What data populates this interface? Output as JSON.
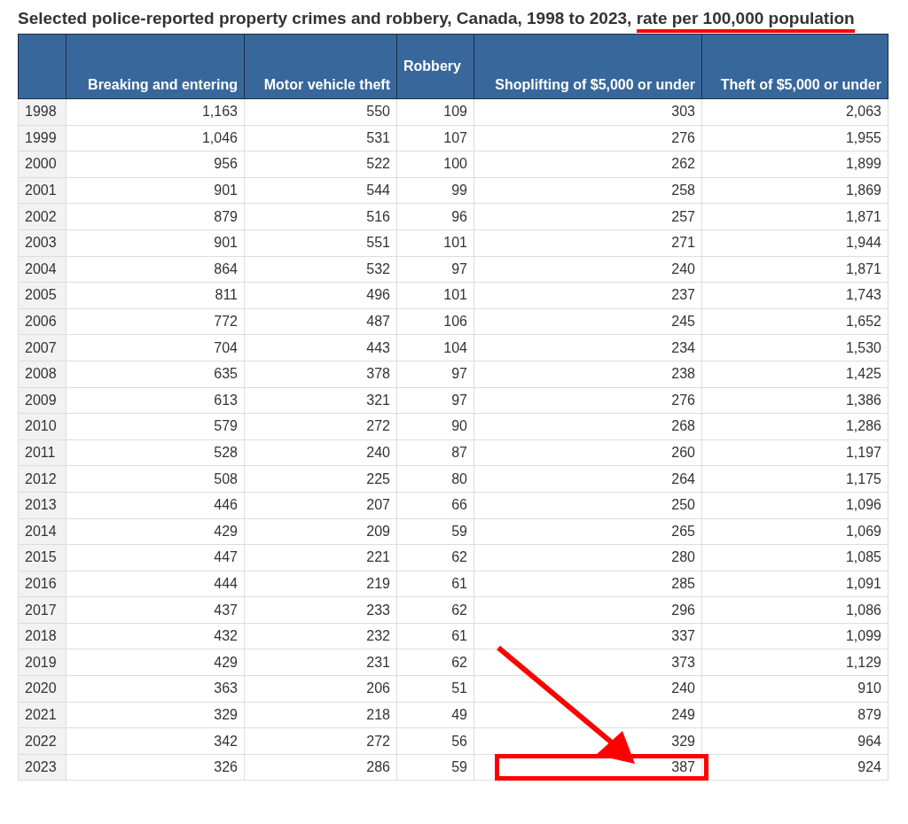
{
  "title": [
    {
      "text": "Selected police-reported property crimes and robbery, Canada, 1998 to 2023,",
      "underlined": false
    },
    {
      "text": "rate per 100,000 population",
      "underlined": true
    }
  ],
  "table": {
    "columns": [
      "",
      "Breaking and entering",
      "Motor vehicle theft",
      "Robbery",
      "Shoplifting of $5,000 or under",
      "Theft of $5,000 or under"
    ],
    "rows": [
      {
        "cells": [
          {
            "text": "1998",
            "boxed": false
          },
          {
            "text": "1,163",
            "boxed": false
          },
          {
            "text": "550",
            "boxed": false
          },
          {
            "text": "109",
            "boxed": false
          },
          {
            "text": "303",
            "boxed": false
          },
          {
            "text": "2,063",
            "boxed": false
          }
        ]
      },
      {
        "cells": [
          {
            "text": "1999",
            "boxed": false
          },
          {
            "text": "1,046",
            "boxed": false
          },
          {
            "text": "531",
            "boxed": false
          },
          {
            "text": "107",
            "boxed": false
          },
          {
            "text": "276",
            "boxed": false
          },
          {
            "text": "1,955",
            "boxed": false
          }
        ]
      },
      {
        "cells": [
          {
            "text": "2000",
            "boxed": false
          },
          {
            "text": "956",
            "boxed": false
          },
          {
            "text": "522",
            "boxed": false
          },
          {
            "text": "100",
            "boxed": false
          },
          {
            "text": "262",
            "boxed": false
          },
          {
            "text": "1,899",
            "boxed": false
          }
        ]
      },
      {
        "cells": [
          {
            "text": "2001",
            "boxed": false
          },
          {
            "text": "901",
            "boxed": false
          },
          {
            "text": "544",
            "boxed": false
          },
          {
            "text": "99",
            "boxed": false
          },
          {
            "text": "258",
            "boxed": false
          },
          {
            "text": "1,869",
            "boxed": false
          }
        ]
      },
      {
        "cells": [
          {
            "text": "2002",
            "boxed": false
          },
          {
            "text": "879",
            "boxed": false
          },
          {
            "text": "516",
            "boxed": false
          },
          {
            "text": "96",
            "boxed": false
          },
          {
            "text": "257",
            "boxed": false
          },
          {
            "text": "1,871",
            "boxed": false
          }
        ]
      },
      {
        "cells": [
          {
            "text": "2003",
            "boxed": false
          },
          {
            "text": "901",
            "boxed": false
          },
          {
            "text": "551",
            "boxed": false
          },
          {
            "text": "101",
            "boxed": false
          },
          {
            "text": "271",
            "boxed": false
          },
          {
            "text": "1,944",
            "boxed": false
          }
        ]
      },
      {
        "cells": [
          {
            "text": "2004",
            "boxed": false
          },
          {
            "text": "864",
            "boxed": false
          },
          {
            "text": "532",
            "boxed": false
          },
          {
            "text": "97",
            "boxed": false
          },
          {
            "text": "240",
            "boxed": false
          },
          {
            "text": "1,871",
            "boxed": false
          }
        ]
      },
      {
        "cells": [
          {
            "text": "2005",
            "boxed": false
          },
          {
            "text": "811",
            "boxed": false
          },
          {
            "text": "496",
            "boxed": false
          },
          {
            "text": "101",
            "boxed": false
          },
          {
            "text": "237",
            "boxed": false
          },
          {
            "text": "1,743",
            "boxed": false
          }
        ]
      },
      {
        "cells": [
          {
            "text": "2006",
            "boxed": false
          },
          {
            "text": "772",
            "boxed": false
          },
          {
            "text": "487",
            "boxed": false
          },
          {
            "text": "106",
            "boxed": false
          },
          {
            "text": "245",
            "boxed": false
          },
          {
            "text": "1,652",
            "boxed": false
          }
        ]
      },
      {
        "cells": [
          {
            "text": "2007",
            "boxed": false
          },
          {
            "text": "704",
            "boxed": false
          },
          {
            "text": "443",
            "boxed": false
          },
          {
            "text": "104",
            "boxed": false
          },
          {
            "text": "234",
            "boxed": false
          },
          {
            "text": "1,530",
            "boxed": false
          }
        ]
      },
      {
        "cells": [
          {
            "text": "2008",
            "boxed": false
          },
          {
            "text": "635",
            "boxed": false
          },
          {
            "text": "378",
            "boxed": false
          },
          {
            "text": "97",
            "boxed": false
          },
          {
            "text": "238",
            "boxed": false
          },
          {
            "text": "1,425",
            "boxed": false
          }
        ]
      },
      {
        "cells": [
          {
            "text": "2009",
            "boxed": false
          },
          {
            "text": "613",
            "boxed": false
          },
          {
            "text": "321",
            "boxed": false
          },
          {
            "text": "97",
            "boxed": false
          },
          {
            "text": "276",
            "boxed": false
          },
          {
            "text": "1,386",
            "boxed": false
          }
        ]
      },
      {
        "cells": [
          {
            "text": "2010",
            "boxed": false
          },
          {
            "text": "579",
            "boxed": false
          },
          {
            "text": "272",
            "boxed": false
          },
          {
            "text": "90",
            "boxed": false
          },
          {
            "text": "268",
            "boxed": false
          },
          {
            "text": "1,286",
            "boxed": false
          }
        ]
      },
      {
        "cells": [
          {
            "text": "2011",
            "boxed": false
          },
          {
            "text": "528",
            "boxed": false
          },
          {
            "text": "240",
            "boxed": false
          },
          {
            "text": "87",
            "boxed": false
          },
          {
            "text": "260",
            "boxed": false
          },
          {
            "text": "1,197",
            "boxed": false
          }
        ]
      },
      {
        "cells": [
          {
            "text": "2012",
            "boxed": false
          },
          {
            "text": "508",
            "boxed": false
          },
          {
            "text": "225",
            "boxed": false
          },
          {
            "text": "80",
            "boxed": false
          },
          {
            "text": "264",
            "boxed": false
          },
          {
            "text": "1,175",
            "boxed": false
          }
        ]
      },
      {
        "cells": [
          {
            "text": "2013",
            "boxed": false
          },
          {
            "text": "446",
            "boxed": false
          },
          {
            "text": "207",
            "boxed": false
          },
          {
            "text": "66",
            "boxed": false
          },
          {
            "text": "250",
            "boxed": false
          },
          {
            "text": "1,096",
            "boxed": false
          }
        ]
      },
      {
        "cells": [
          {
            "text": "2014",
            "boxed": false
          },
          {
            "text": "429",
            "boxed": false
          },
          {
            "text": "209",
            "boxed": false
          },
          {
            "text": "59",
            "boxed": false
          },
          {
            "text": "265",
            "boxed": false
          },
          {
            "text": "1,069",
            "boxed": false
          }
        ]
      },
      {
        "cells": [
          {
            "text": "2015",
            "boxed": false
          },
          {
            "text": "447",
            "boxed": false
          },
          {
            "text": "221",
            "boxed": false
          },
          {
            "text": "62",
            "boxed": false
          },
          {
            "text": "280",
            "boxed": false
          },
          {
            "text": "1,085",
            "boxed": false
          }
        ]
      },
      {
        "cells": [
          {
            "text": "2016",
            "boxed": false
          },
          {
            "text": "444",
            "boxed": false
          },
          {
            "text": "219",
            "boxed": false
          },
          {
            "text": "61",
            "boxed": false
          },
          {
            "text": "285",
            "boxed": false
          },
          {
            "text": "1,091",
            "boxed": false
          }
        ]
      },
      {
        "cells": [
          {
            "text": "2017",
            "boxed": false
          },
          {
            "text": "437",
            "boxed": false
          },
          {
            "text": "233",
            "boxed": false
          },
          {
            "text": "62",
            "boxed": false
          },
          {
            "text": "296",
            "boxed": false
          },
          {
            "text": "1,086",
            "boxed": false
          }
        ]
      },
      {
        "cells": [
          {
            "text": "2018",
            "boxed": false
          },
          {
            "text": "432",
            "boxed": false
          },
          {
            "text": "232",
            "boxed": false
          },
          {
            "text": "61",
            "boxed": false
          },
          {
            "text": "337",
            "boxed": false
          },
          {
            "text": "1,099",
            "boxed": false
          }
        ]
      },
      {
        "cells": [
          {
            "text": "2019",
            "boxed": false
          },
          {
            "text": "429",
            "boxed": false
          },
          {
            "text": "231",
            "boxed": false
          },
          {
            "text": "62",
            "boxed": false
          },
          {
            "text": "373",
            "boxed": false
          },
          {
            "text": "1,129",
            "boxed": false
          }
        ]
      },
      {
        "cells": [
          {
            "text": "2020",
            "boxed": false
          },
          {
            "text": "363",
            "boxed": false
          },
          {
            "text": "206",
            "boxed": false
          },
          {
            "text": "51",
            "boxed": false
          },
          {
            "text": "240",
            "boxed": false
          },
          {
            "text": "910",
            "boxed": false
          }
        ]
      },
      {
        "cells": [
          {
            "text": "2021",
            "boxed": false
          },
          {
            "text": "329",
            "boxed": false
          },
          {
            "text": "218",
            "boxed": false
          },
          {
            "text": "49",
            "boxed": false
          },
          {
            "text": "249",
            "boxed": false
          },
          {
            "text": "879",
            "boxed": false
          }
        ]
      },
      {
        "cells": [
          {
            "text": "2022",
            "boxed": false
          },
          {
            "text": "342",
            "boxed": false
          },
          {
            "text": "272",
            "boxed": false
          },
          {
            "text": "56",
            "boxed": false
          },
          {
            "text": "329",
            "boxed": false
          },
          {
            "text": "964",
            "boxed": false
          }
        ]
      },
      {
        "cells": [
          {
            "text": "2023",
            "boxed": false
          },
          {
            "text": "326",
            "boxed": false
          },
          {
            "text": "286",
            "boxed": false
          },
          {
            "text": "59",
            "boxed": false
          },
          {
            "text": "387",
            "boxed": true
          },
          {
            "text": "924",
            "boxed": false
          }
        ]
      }
    ]
  }
}
